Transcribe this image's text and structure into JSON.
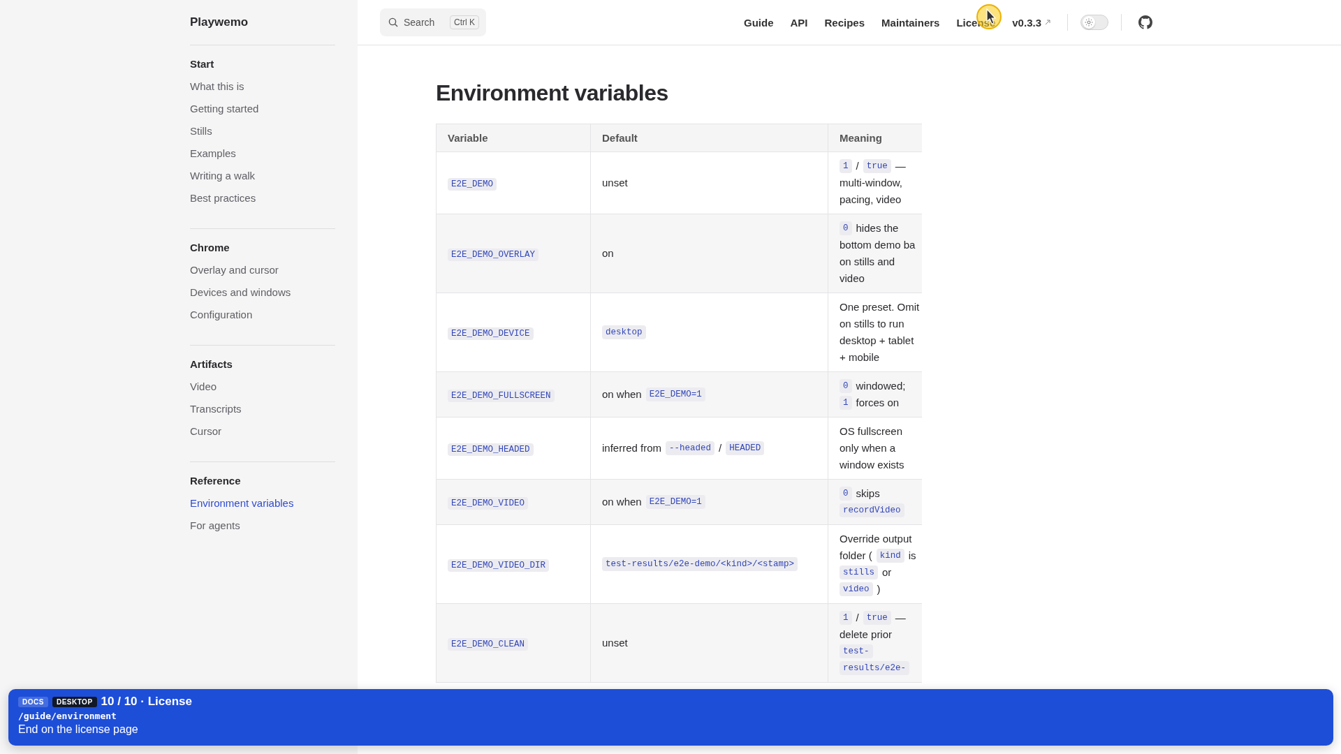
{
  "sidebar": {
    "brand": "Playwemo",
    "groups": [
      {
        "title": "Start",
        "items": [
          {
            "label": "What this is",
            "selected": false
          },
          {
            "label": "Getting started",
            "selected": false
          },
          {
            "label": "Stills",
            "selected": false
          },
          {
            "label": "Examples",
            "selected": false
          },
          {
            "label": "Writing a walk",
            "selected": false
          },
          {
            "label": "Best practices",
            "selected": false
          }
        ]
      },
      {
        "title": "Chrome",
        "items": [
          {
            "label": "Overlay and cursor",
            "selected": false
          },
          {
            "label": "Devices and windows",
            "selected": false
          },
          {
            "label": "Configuration",
            "selected": false
          }
        ]
      },
      {
        "title": "Artifacts",
        "items": [
          {
            "label": "Video",
            "selected": false
          },
          {
            "label": "Transcripts",
            "selected": false
          },
          {
            "label": "Cursor",
            "selected": false
          }
        ]
      },
      {
        "title": "Reference",
        "items": [
          {
            "label": "Environment variables",
            "selected": true
          },
          {
            "label": "For agents",
            "selected": false
          }
        ]
      }
    ]
  },
  "header": {
    "search": {
      "placeholder": "Search",
      "shortcut": "Ctrl K"
    },
    "nav": [
      {
        "label": "Guide"
      },
      {
        "label": "API"
      },
      {
        "label": "Recipes"
      },
      {
        "label": "Maintainers"
      },
      {
        "label": "License"
      },
      {
        "label": "v0.3.3",
        "external": true
      }
    ],
    "theme_toggle": {
      "on": false
    }
  },
  "page": {
    "title": "Environment variables",
    "table": {
      "columns": [
        "Variable",
        "Default",
        "Meaning"
      ],
      "rows": [
        {
          "variable": "E2E_DEMO",
          "default": [
            {
              "kind": "text",
              "text": "unset"
            }
          ],
          "meaning": [
            [
              {
                "kind": "code",
                "text": "1"
              },
              {
                "kind": "text",
                "text": "/"
              },
              {
                "kind": "code",
                "text": "true"
              },
              {
                "kind": "text",
                "text": "—"
              }
            ],
            [
              {
                "kind": "text",
                "text": "multi-window,"
              }
            ],
            [
              {
                "kind": "text",
                "text": "pacing, video"
              }
            ]
          ]
        },
        {
          "variable": "E2E_DEMO_OVERLAY",
          "default": [
            {
              "kind": "text",
              "text": "on"
            }
          ],
          "meaning": [
            [
              {
                "kind": "code",
                "text": "0"
              },
              {
                "kind": "text",
                "text": "hides the"
              }
            ],
            [
              {
                "kind": "text",
                "text": "bottom demo ba"
              }
            ],
            [
              {
                "kind": "text",
                "text": "on stills and"
              }
            ],
            [
              {
                "kind": "text",
                "text": "video"
              }
            ]
          ]
        },
        {
          "variable": "E2E_DEMO_DEVICE",
          "default": [
            {
              "kind": "code",
              "text": "desktop"
            }
          ],
          "meaning": [
            [
              {
                "kind": "text",
                "text": "One preset. Omit"
              }
            ],
            [
              {
                "kind": "text",
                "text": "on stills to run"
              }
            ],
            [
              {
                "kind": "text",
                "text": "desktop + tablet"
              }
            ],
            [
              {
                "kind": "text",
                "text": "+ mobile"
              }
            ]
          ]
        },
        {
          "variable": "E2E_DEMO_FULLSCREEN",
          "default": [
            {
              "kind": "text",
              "text": "on when"
            },
            {
              "kind": "code",
              "text": "E2E_DEMO=1"
            }
          ],
          "meaning": [
            [
              {
                "kind": "code",
                "text": "0"
              },
              {
                "kind": "text",
                "text": "windowed;"
              }
            ],
            [
              {
                "kind": "code",
                "text": "1"
              },
              {
                "kind": "text",
                "text": "forces on"
              }
            ]
          ]
        },
        {
          "variable": "E2E_DEMO_HEADED",
          "default": [
            {
              "kind": "text",
              "text": "inferred from"
            },
            {
              "kind": "code",
              "text": "--headed"
            },
            {
              "kind": "text",
              "text": "/"
            },
            {
              "kind": "code",
              "text": "HEADED"
            }
          ],
          "meaning": [
            [
              {
                "kind": "text",
                "text": "OS fullscreen"
              }
            ],
            [
              {
                "kind": "text",
                "text": "only when a"
              }
            ],
            [
              {
                "kind": "text",
                "text": "window exists"
              }
            ]
          ]
        },
        {
          "variable": "E2E_DEMO_VIDEO",
          "default": [
            {
              "kind": "text",
              "text": "on when"
            },
            {
              "kind": "code",
              "text": "E2E_DEMO=1"
            }
          ],
          "meaning": [
            [
              {
                "kind": "code",
                "text": "0"
              },
              {
                "kind": "text",
                "text": "skips"
              }
            ],
            [
              {
                "kind": "code",
                "text": "recordVideo"
              }
            ]
          ]
        },
        {
          "variable": "E2E_DEMO_VIDEO_DIR",
          "default": [
            {
              "kind": "code",
              "text": "test-results/e2e-demo/<kind>/<stamp>"
            }
          ],
          "meaning": [
            [
              {
                "kind": "text",
                "text": "Override output"
              }
            ],
            [
              {
                "kind": "text",
                "text": "folder ("
              },
              {
                "kind": "code",
                "text": "kind"
              },
              {
                "kind": "text",
                "text": "is"
              }
            ],
            [
              {
                "kind": "code",
                "text": "stills"
              },
              {
                "kind": "text",
                "text": "or"
              }
            ],
            [
              {
                "kind": "code",
                "text": "video"
              },
              {
                "kind": "text",
                "text": ")"
              }
            ]
          ]
        },
        {
          "variable": "E2E_DEMO_CLEAN",
          "default": [
            {
              "kind": "text",
              "text": "unset"
            }
          ],
          "meaning": [
            [
              {
                "kind": "code",
                "text": "1"
              },
              {
                "kind": "text",
                "text": "/"
              },
              {
                "kind": "code",
                "text": "true"
              },
              {
                "kind": "text",
                "text": "—"
              }
            ],
            [
              {
                "kind": "text",
                "text": "delete prior"
              }
            ],
            [
              {
                "kind": "code",
                "text": "test-"
              }
            ],
            [
              {
                "kind": "code",
                "text": "results/e2e-"
              }
            ]
          ]
        }
      ]
    }
  },
  "overlay": {
    "badges": [
      {
        "label": "DOCS",
        "kind": "light"
      },
      {
        "label": "DESKTOP",
        "kind": "dark"
      }
    ],
    "step": "10 / 10 · License",
    "path": "/guide/environment",
    "caption": "End on the license page"
  }
}
